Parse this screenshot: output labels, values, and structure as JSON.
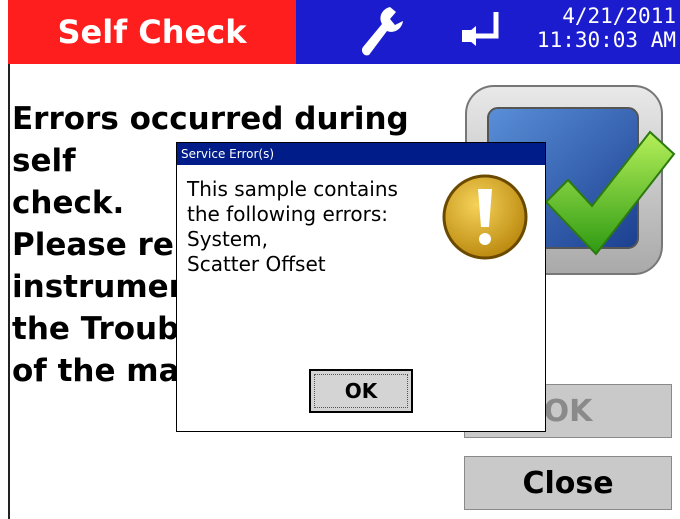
{
  "header": {
    "title": "Self Check",
    "date": "4/21/2011",
    "time": "11:30:03 AM",
    "icons": [
      "wrench-icon",
      "exit-icon"
    ],
    "colors": {
      "title_bg": "#ff1e1e",
      "bar_bg": "#1c1ccf"
    }
  },
  "main": {
    "message_lines": [
      "Errors occurred during self",
      "check.",
      "Please reb",
      "instrument",
      "the Troubl",
      "of the mar"
    ],
    "image_icon": "check-mark-icon",
    "ok_label": "OK",
    "close_label": "Close"
  },
  "dialog": {
    "title": "Service Error(s)",
    "message": "This sample contains\nthe following errors:\nSystem,\nScatter Offset",
    "icon": "warning-icon",
    "ok_label": "OK"
  }
}
